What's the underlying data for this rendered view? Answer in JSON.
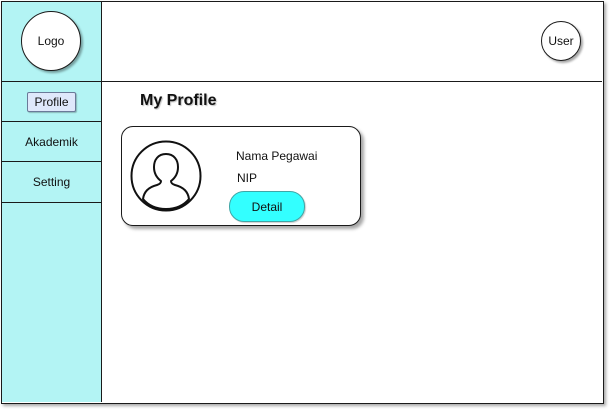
{
  "sidebar": {
    "logo_label": "Logo",
    "items": [
      {
        "label": "Profile",
        "active": true
      },
      {
        "label": "Akademik",
        "active": false
      },
      {
        "label": "Setting",
        "active": false
      }
    ],
    "background_color": "#b3f4f4"
  },
  "header": {
    "user_label": "User"
  },
  "main": {
    "page_title": "My Profile",
    "profile_card": {
      "avatar_icon": "user-silhouette-icon",
      "name_label": "Nama Pegawai",
      "nip_label": "NIP",
      "detail_button_label": "Detail",
      "detail_button_color": "#33ffff"
    }
  }
}
